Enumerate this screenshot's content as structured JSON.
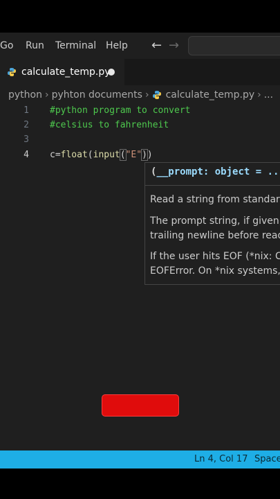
{
  "menu": {
    "items": [
      "Go",
      "Run",
      "Terminal",
      "Help"
    ],
    "back": "←",
    "forward": "→"
  },
  "tab": {
    "label": "calculate_temp.py"
  },
  "breadcrumb": {
    "parts": [
      "python",
      "pyhton documents",
      "calculate_temp.py",
      "..."
    ]
  },
  "editor": {
    "lines": [
      {
        "number": "1",
        "text": "#python program to convert"
      },
      {
        "number": "2",
        "text": "#celsius to fahrenheit"
      },
      {
        "number": "3",
        "text": ""
      },
      {
        "number": "4",
        "prefix": "c=",
        "fn1": "float",
        "fn2": "input",
        "string": "\"E\""
      }
    ]
  },
  "hover": {
    "signature_open": "(",
    "signature": "__prompt: object = ...",
    "lines": [
      "Read a string from standard",
      "The prompt string, if given,",
      "trailing newline before read",
      "If the user hits EOF (*nix: Ct",
      "EOFError. On *nix systems,"
    ]
  },
  "status": {
    "position": "Ln 4, Col 17",
    "spaces": "Spaces"
  },
  "colors": {
    "status_bar": "#1eaee6",
    "red_bar": "#e00c0c",
    "comment": "#4ec94e"
  }
}
